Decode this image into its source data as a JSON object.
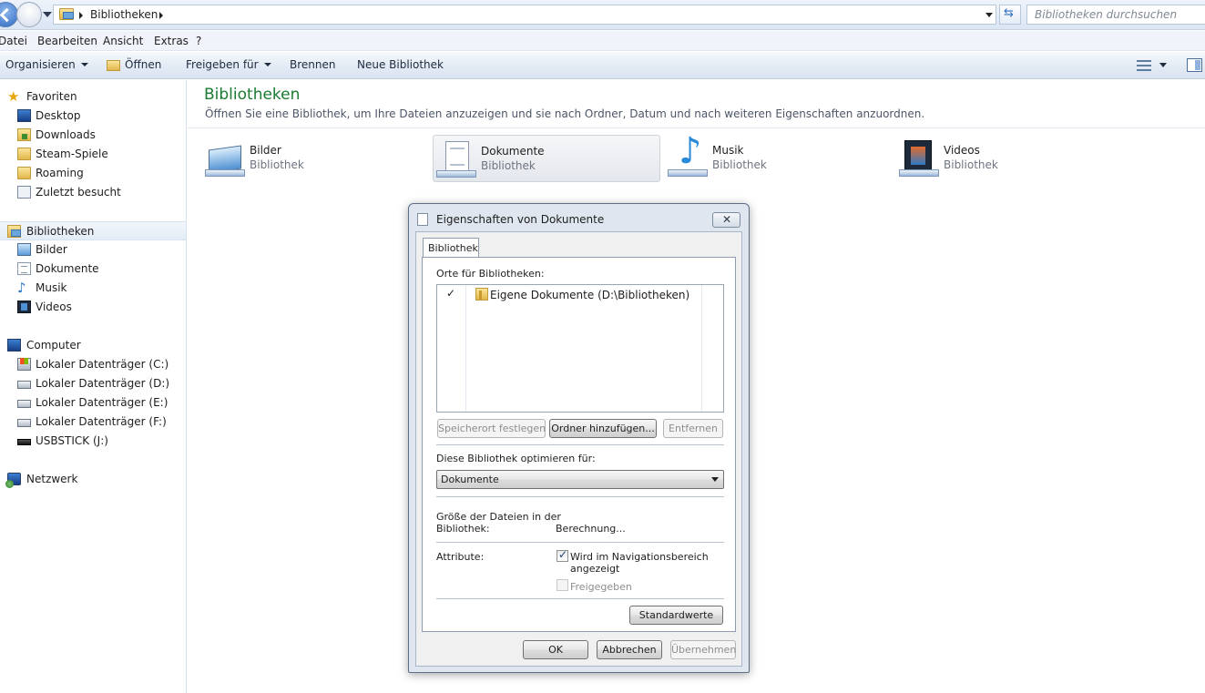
{
  "address_bar": {
    "breadcrumb": "Bibliotheken",
    "search_placeholder": "Bibliotheken durchsuchen"
  },
  "menu": {
    "items": [
      "Datei",
      "Bearbeiten",
      "Ansicht",
      "Extras",
      "?"
    ]
  },
  "command_bar": {
    "organize": "Organisieren",
    "open": "Öffnen",
    "share": "Freigeben für",
    "burn": "Brennen",
    "new_library": "Neue Bibliothek"
  },
  "nav": {
    "favorites": {
      "label": "Favoriten",
      "items": [
        "Desktop",
        "Downloads",
        "Steam-Spiele",
        "Roaming",
        "Zuletzt besucht"
      ]
    },
    "libraries": {
      "label": "Bibliotheken",
      "items": [
        "Bilder",
        "Dokumente",
        "Musik",
        "Videos"
      ]
    },
    "computer": {
      "label": "Computer",
      "items": [
        "Lokaler Datenträger (C:)",
        "Lokaler Datenträger (D:)",
        "Lokaler Datenträger (E:)",
        "Lokaler Datenträger (F:)",
        "USBSTICK (J:)"
      ]
    },
    "network": {
      "label": "Netzwerk"
    }
  },
  "content": {
    "title": "Bibliotheken",
    "subtitle": "Öffnen Sie eine Bibliothek, um Ihre Dateien anzuzeigen und sie nach Ordner, Datum und nach weiteren Eigenschaften anzuordnen.",
    "libraries": [
      {
        "name": "Bilder",
        "type": "Bibliothek",
        "icon": "pictures-library-icon"
      },
      {
        "name": "Dokumente",
        "type": "Bibliothek",
        "icon": "documents-library-icon"
      },
      {
        "name": "Musik",
        "type": "Bibliothek",
        "icon": "music-library-icon"
      },
      {
        "name": "Videos",
        "type": "Bibliothek",
        "icon": "videos-library-icon"
      }
    ]
  },
  "dialog": {
    "title": "Eigenschaften von Dokumente",
    "tab": "Bibliothek",
    "locations_label": "Orte für Bibliotheken:",
    "location": {
      "check": "✓",
      "path": "Eigene Dokumente (D:\\Bibliotheken)"
    },
    "buttons": {
      "set_location": "Speicherort festlegen",
      "add_folder": "Ordner hinzufügen...",
      "remove": "Entfernen",
      "defaults": "Standardwerte",
      "ok": "OK",
      "cancel": "Abbrechen",
      "apply": "Übernehmen"
    },
    "optimize_label": "Diese Bibliothek optimieren für:",
    "optimize_value": "Dokumente",
    "size_label_line1": "Größe der Dateien in der",
    "size_label_line2": "Bibliothek:",
    "size_value": "Berechnung...",
    "attributes_label": "Attribute:",
    "attr_nav_line1": "Wird im Navigationsbereich",
    "attr_nav_line2": "angezeigt",
    "attr_nav_checked": true,
    "attr_shared": "Freigegeben",
    "attr_shared_checked": false
  },
  "colors": {
    "title_green": "#1b7a30",
    "accent_blue": "#2d6fc0"
  }
}
